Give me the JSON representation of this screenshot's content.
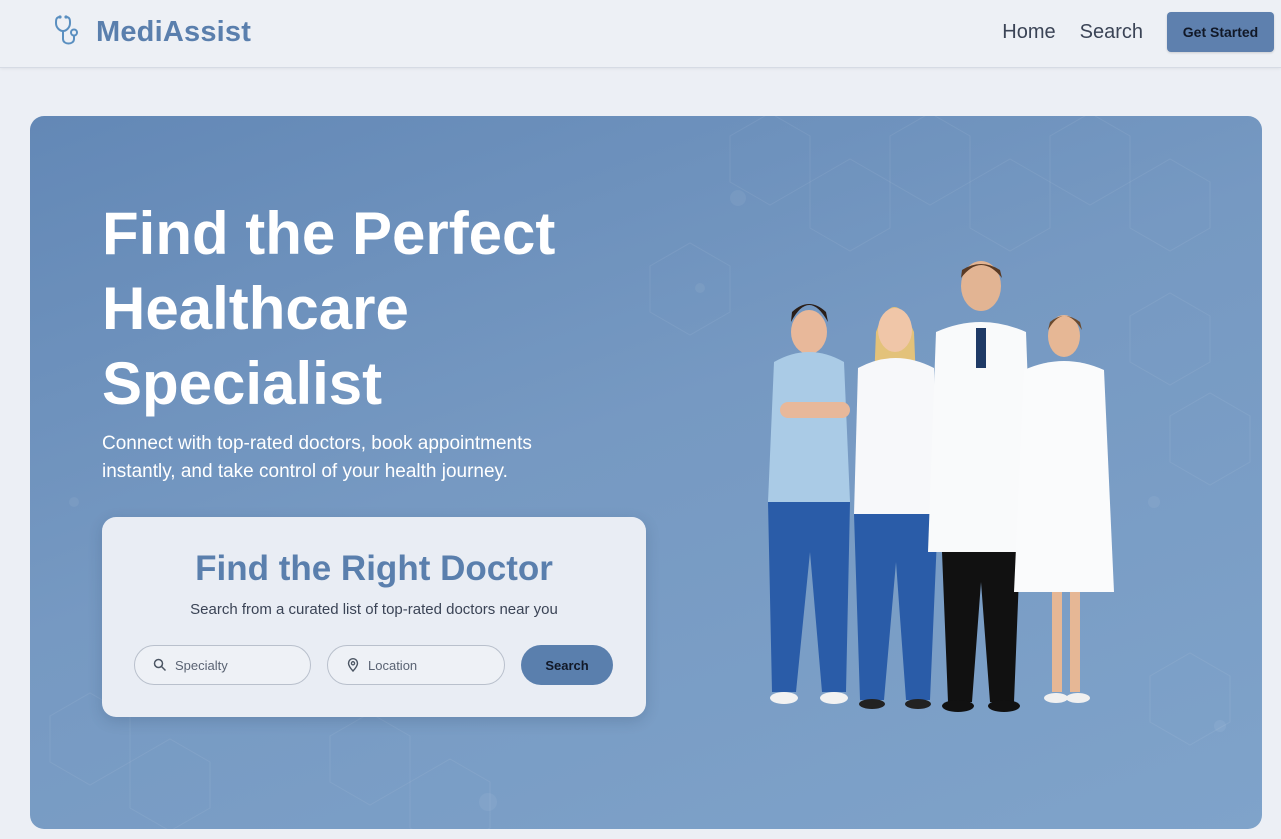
{
  "header": {
    "brand": "MediAssist",
    "brand_icon": "stethoscope-icon",
    "nav": {
      "home": "Home",
      "search": "Search",
      "cta": "Get Started"
    }
  },
  "hero": {
    "title": "Find the Perfect Healthcare Specialist",
    "subtitle": "Connect with top-rated doctors, book appointments instantly, and take control of your health journey.",
    "image_icon": "doctors-group-photo"
  },
  "search_card": {
    "title": "Find the Right Doctor",
    "subtitle": "Search from a curated list of top-rated doctors near you",
    "specialty": {
      "value": "",
      "placeholder": "Specialty",
      "icon": "search-icon"
    },
    "location": {
      "value": "",
      "placeholder": "Location",
      "icon": "location-pin-icon"
    },
    "button": "Search"
  },
  "colors": {
    "accent": "#5a7fad",
    "hero_start": "#6388b6",
    "hero_end": "#7fa3ca",
    "page_bg": "#eceff5"
  }
}
